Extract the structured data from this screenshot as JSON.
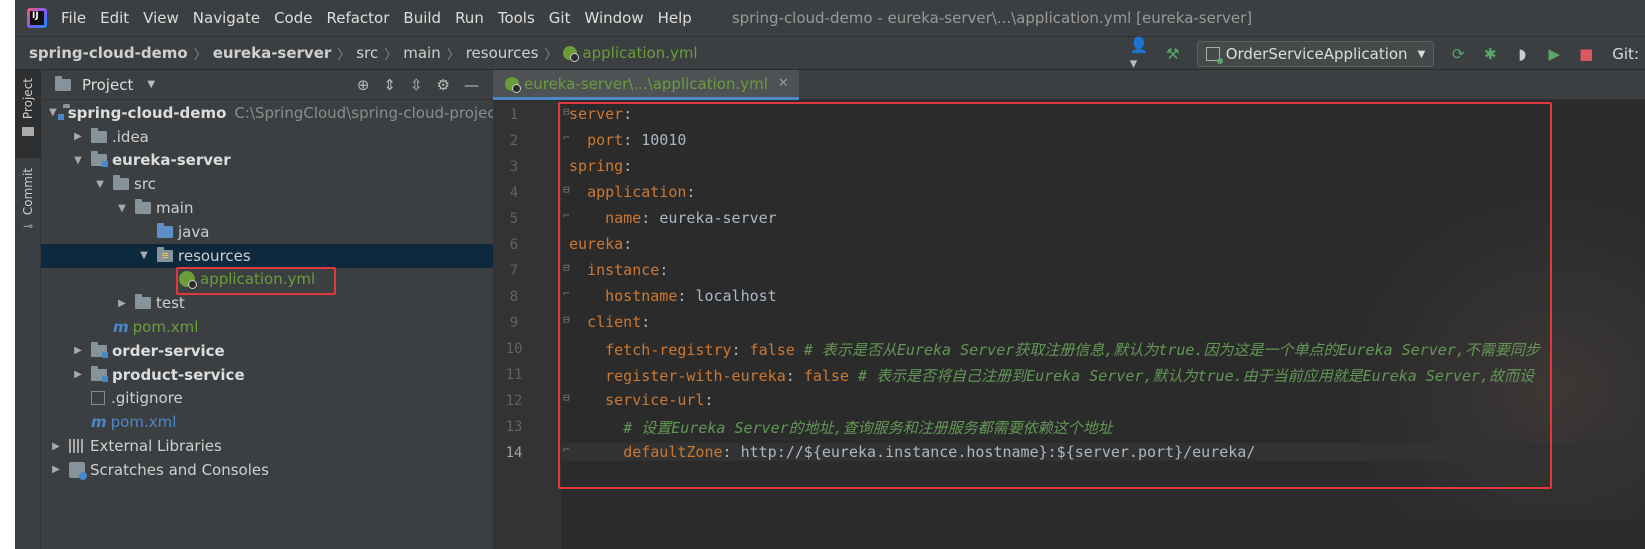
{
  "menubar": {
    "items": [
      "File",
      "Edit",
      "View",
      "Navigate",
      "Code",
      "Refactor",
      "Build",
      "Run",
      "Tools",
      "Git",
      "Window",
      "Help"
    ],
    "window_title": "spring-cloud-demo - eureka-server\\...\\application.yml [eureka-server]"
  },
  "navbar": {
    "crumbs": [
      "spring-cloud-demo",
      "eureka-server",
      "src",
      "main",
      "resources",
      "application.yml"
    ],
    "run_config": "OrderServiceApplication",
    "git_label": "Git:"
  },
  "tool_strip": {
    "project_tab": "Project",
    "commit_tab": "Commit"
  },
  "project_panel": {
    "title": "Project",
    "tree": [
      {
        "label": "spring-cloud-demo",
        "path": "C:\\SpringCloud\\spring-cloud-project"
      },
      {
        "label": ".idea"
      },
      {
        "label": "eureka-server"
      },
      {
        "label": "src"
      },
      {
        "label": "main"
      },
      {
        "label": "java"
      },
      {
        "label": "resources"
      },
      {
        "label": "application.yml"
      },
      {
        "label": "test"
      },
      {
        "label": "pom.xml"
      },
      {
        "label": "order-service"
      },
      {
        "label": "product-service"
      },
      {
        "label": ".gitignore"
      },
      {
        "label": "pom.xml"
      },
      {
        "label": "External Libraries"
      },
      {
        "label": "Scratches and Consoles"
      }
    ]
  },
  "editor": {
    "tab_label": "eureka-server\\...\\application.yml",
    "lines": [
      {
        "n": "1",
        "key": "server",
        "sep": ":",
        "val": "",
        "comment": ""
      },
      {
        "n": "2",
        "key": "port",
        "sep": ": ",
        "val": "10010",
        "comment": ""
      },
      {
        "n": "3",
        "key": "spring",
        "sep": ":",
        "val": "",
        "comment": ""
      },
      {
        "n": "4",
        "key": "application",
        "sep": ":",
        "val": "",
        "comment": ""
      },
      {
        "n": "5",
        "key": "name",
        "sep": ": ",
        "val": "eureka-server",
        "comment": ""
      },
      {
        "n": "6",
        "key": "eureka",
        "sep": ":",
        "val": "",
        "comment": ""
      },
      {
        "n": "7",
        "key": "instance",
        "sep": ":",
        "val": "",
        "comment": ""
      },
      {
        "n": "8",
        "key": "hostname",
        "sep": ": ",
        "val": "localhost",
        "comment": ""
      },
      {
        "n": "9",
        "key": "client",
        "sep": ":",
        "val": "",
        "comment": ""
      },
      {
        "n": "10",
        "key": "fetch-registry",
        "sep": ": ",
        "val": "false ",
        "comment": "# 表示是否从Eureka Server获取注册信息,默认为true.因为这是一个单点的Eureka Server,不需要同步"
      },
      {
        "n": "11",
        "key": "register-with-eureka",
        "sep": ": ",
        "val": "false ",
        "comment": "# 表示是否将自己注册到Eureka Server,默认为true.由于当前应用就是Eureka Server,故而设"
      },
      {
        "n": "12",
        "key": "service-url",
        "sep": ":",
        "val": "",
        "comment": ""
      },
      {
        "n": "13",
        "key": "",
        "sep": "",
        "val": "",
        "comment": "# 设置Eureka Server的地址,查询服务和注册服务都需要依赖这个地址"
      },
      {
        "n": "14",
        "key": "defaultZone",
        "sep": ": ",
        "val": "http://${eureka.instance.hostname}:${server.port}/eureka/",
        "comment": ""
      }
    ]
  },
  "colors": {
    "highlight_box": "#e0383f",
    "yaml_key": "#cc7832",
    "comment": "#629755",
    "selection": "#0d293e"
  }
}
